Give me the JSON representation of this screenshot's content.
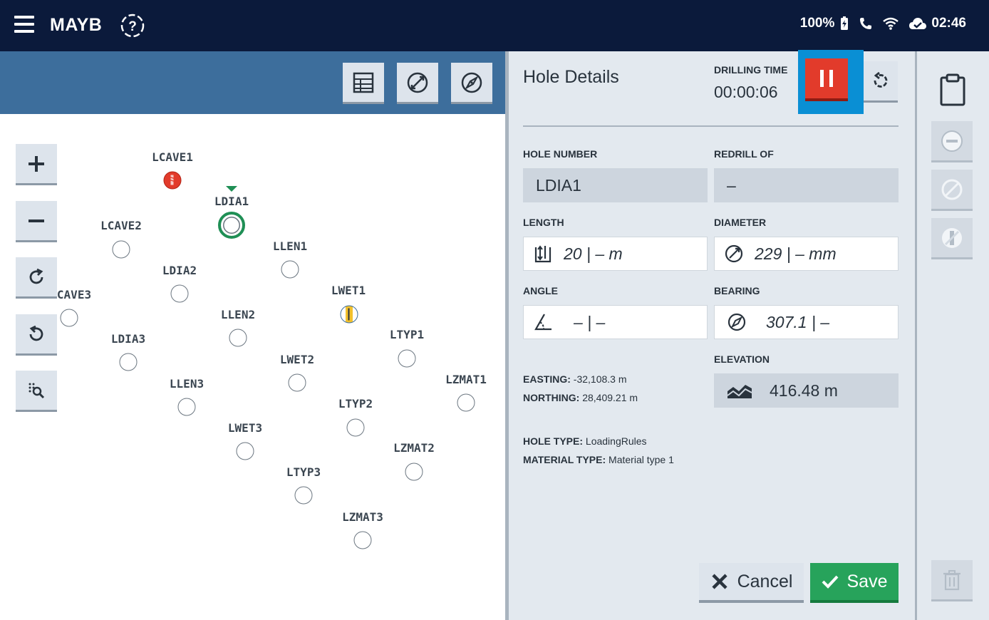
{
  "topbar": {
    "title": "MAYB",
    "battery": "100%",
    "time": "02:46"
  },
  "map": {
    "tools": [
      "grid-icon",
      "diameter-icon",
      "compass-icon"
    ],
    "zoom_controls": [
      "plus-icon",
      "minus-icon",
      "rotate-cw-icon",
      "rotate-ccw-icon",
      "zoom-fit-icon"
    ],
    "holes": [
      {
        "name": "LCAVE1",
        "status": "drilling"
      },
      {
        "name": "LDIA1",
        "status": "selected"
      },
      {
        "name": "LCAVE2",
        "status": "pending"
      },
      {
        "name": "LLEN1",
        "status": "pending"
      },
      {
        "name": "LDIA2",
        "status": "pending"
      },
      {
        "name": "LWET1",
        "status": "wet"
      },
      {
        "name": "CAVE3",
        "status": "pending"
      },
      {
        "name": "LLEN2",
        "status": "pending"
      },
      {
        "name": "LTYP1",
        "status": "pending"
      },
      {
        "name": "LDIA3",
        "status": "pending"
      },
      {
        "name": "LWET2",
        "status": "pending"
      },
      {
        "name": "LZMAT1",
        "status": "pending"
      },
      {
        "name": "LLEN3",
        "status": "pending"
      },
      {
        "name": "LTYP2",
        "status": "pending"
      },
      {
        "name": "LWET3",
        "status": "pending"
      },
      {
        "name": "LZMAT2",
        "status": "pending"
      },
      {
        "name": "LTYP3",
        "status": "pending"
      },
      {
        "name": "LZMAT3",
        "status": "pending"
      }
    ]
  },
  "panel": {
    "title": "Hole Details",
    "drilling_time_label": "DRILLING TIME",
    "drilling_time": "00:00:06",
    "hole_number_label": "HOLE NUMBER",
    "hole_number": "LDIA1",
    "redrill_label": "REDRILL OF",
    "redrill": "–",
    "length_label": "LENGTH",
    "length": "20 | – m",
    "diameter_label": "DIAMETER",
    "diameter": "229 | – mm",
    "angle_label": "ANGLE",
    "angle": "– | –",
    "bearing_label": "BEARING",
    "bearing": "307.1 | –",
    "elevation_label": "ELEVATION",
    "elevation": "416.48  m",
    "easting_label": "EASTING:",
    "easting": "-32,108.3 m",
    "northing_label": "NORTHING:",
    "northing": "28,409.21 m",
    "hole_type_label": "HOLE TYPE:",
    "hole_type": "LoadingRules",
    "material_type_label": "MATERIAL TYPE:",
    "material_type": "Material type 1",
    "cancel_label": "Cancel",
    "save_label": "Save"
  },
  "colors": {
    "topbar": "#0b1a3b",
    "map_header": "#3d6e9c",
    "pause": "#e23b2b",
    "highlight": "#0a8fd4",
    "save": "#27a35b",
    "selected_ring": "#1f8f55"
  }
}
